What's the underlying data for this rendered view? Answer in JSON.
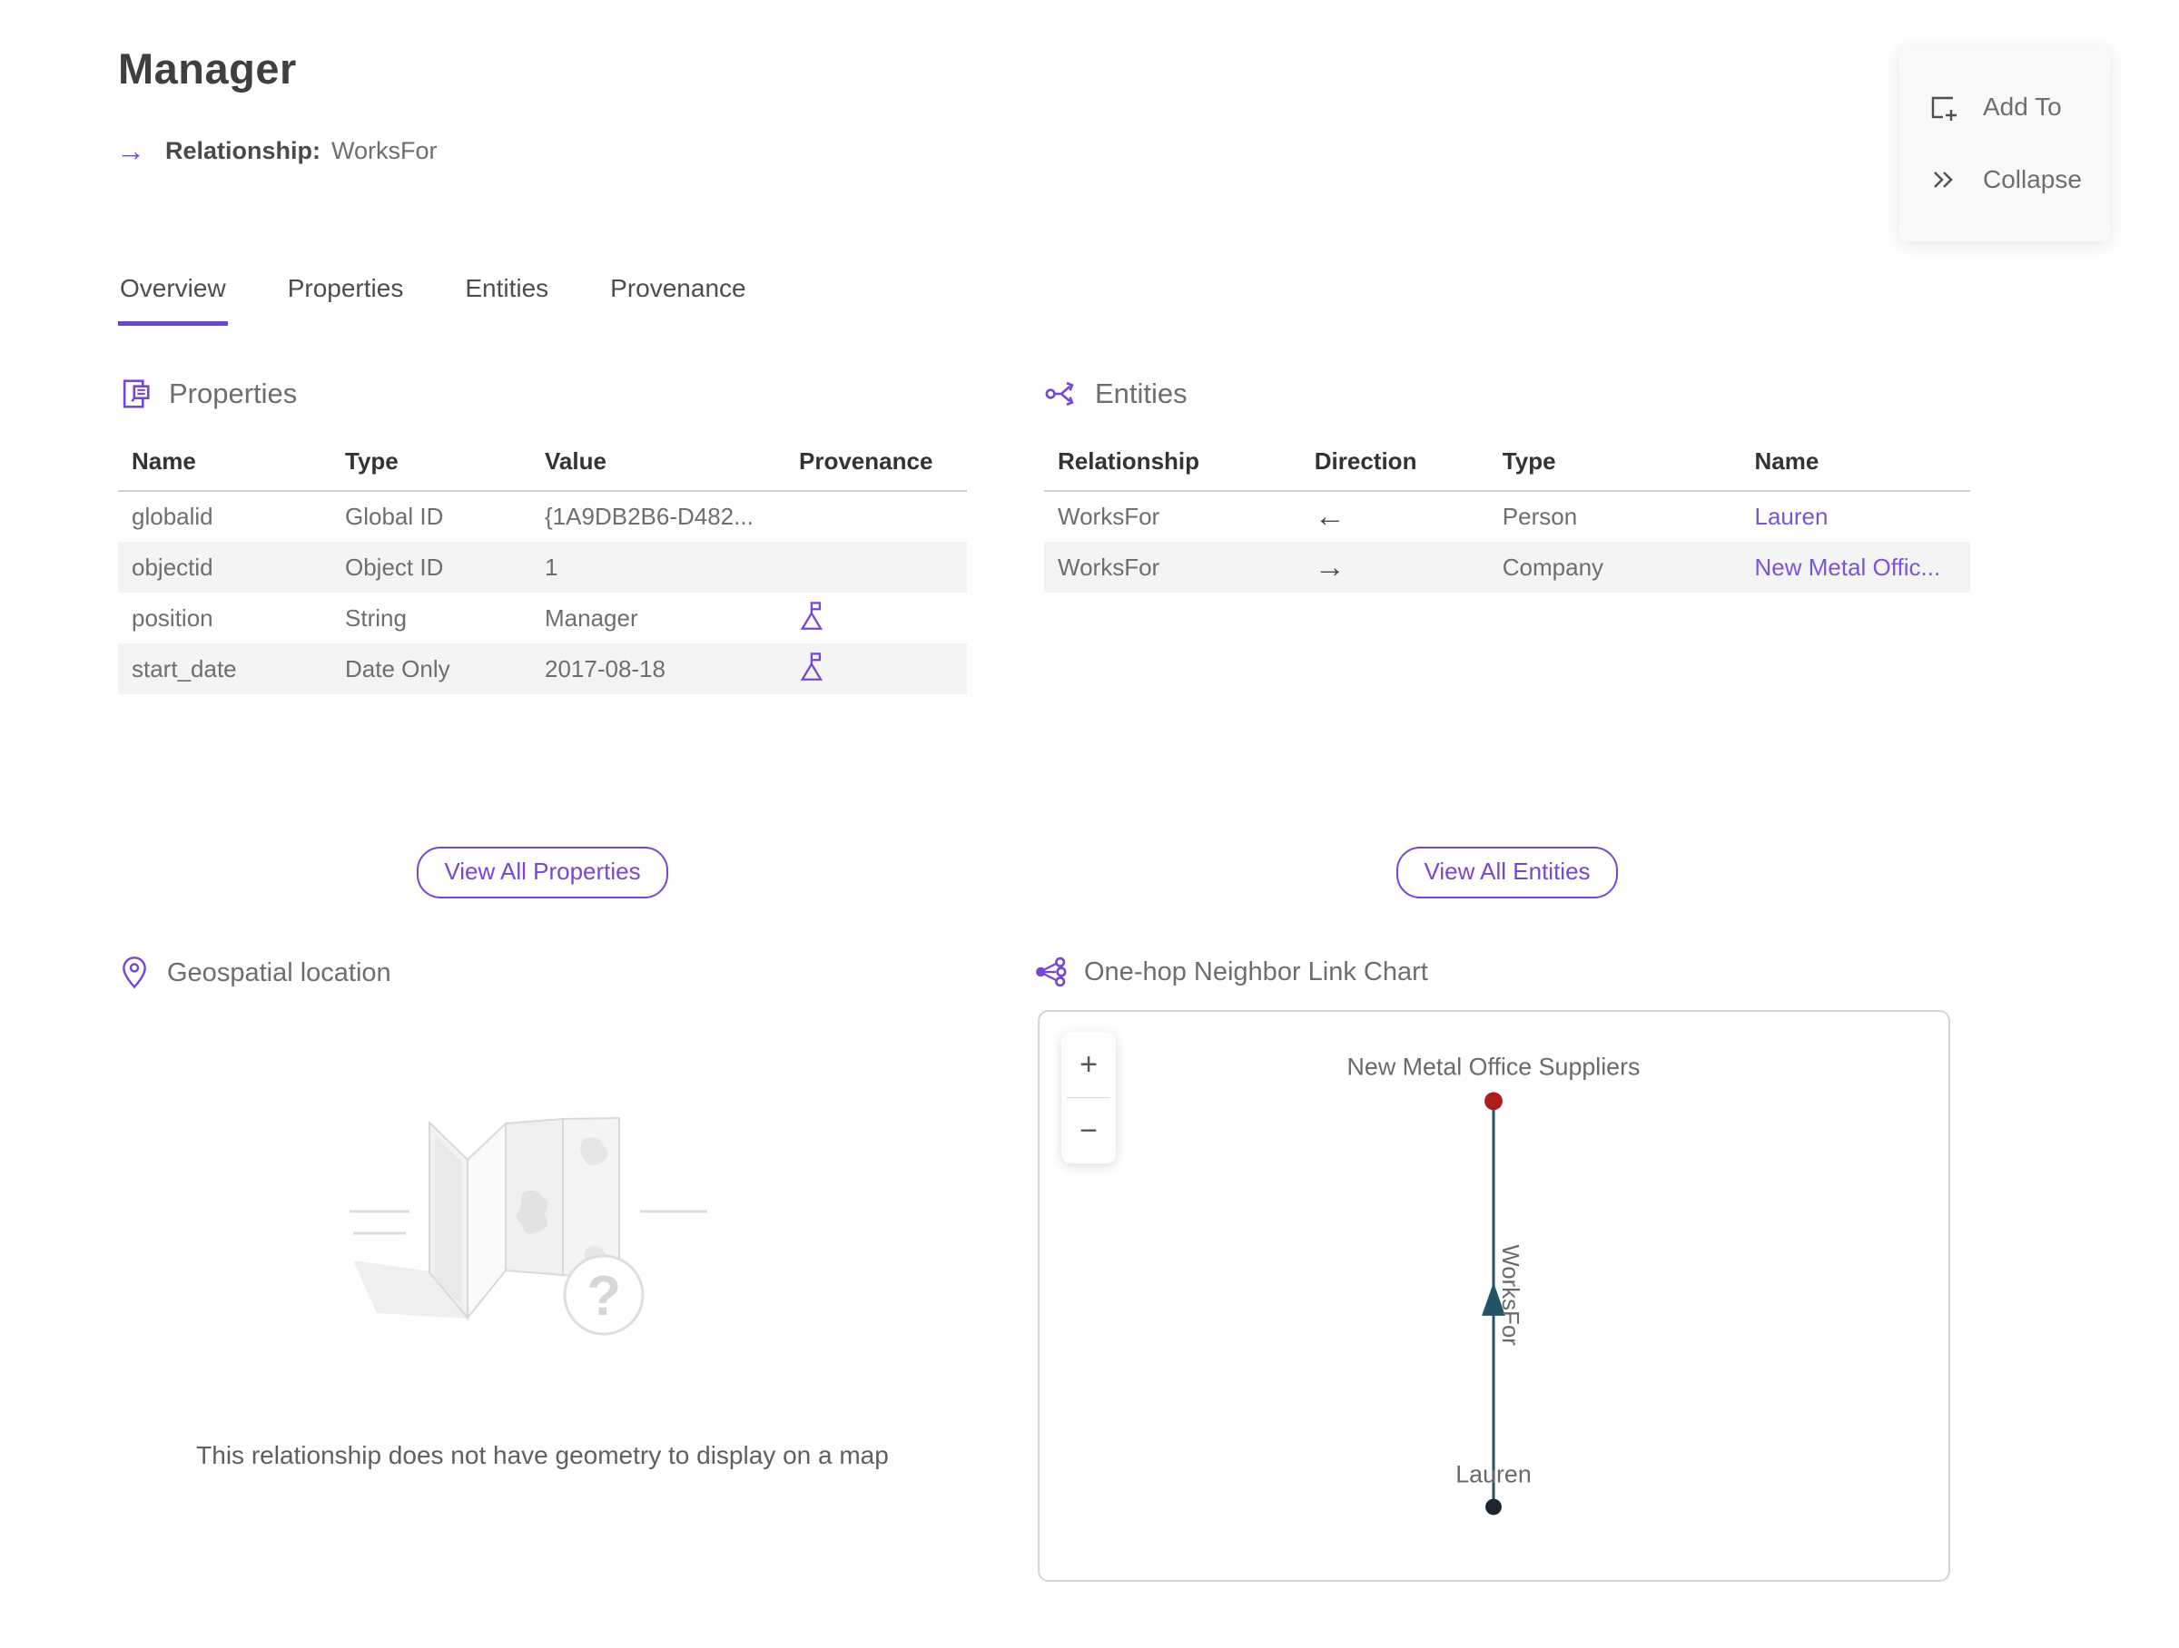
{
  "page": {
    "title": "Manager",
    "subtitle_label": "Relationship:",
    "subtitle_value": "WorksFor"
  },
  "actions": {
    "add_to": "Add To",
    "collapse": "Collapse"
  },
  "tabs": [
    {
      "label": "Overview",
      "active": true
    },
    {
      "label": "Properties",
      "active": false
    },
    {
      "label": "Entities",
      "active": false
    },
    {
      "label": "Provenance",
      "active": false
    }
  ],
  "properties_section": {
    "title": "Properties",
    "columns": [
      "Name",
      "Type",
      "Value",
      "Provenance"
    ],
    "rows": [
      {
        "name": "globalid",
        "type": "Global ID",
        "value": "{1A9DB2B6-D482...",
        "has_provenance": false
      },
      {
        "name": "objectid",
        "type": "Object ID",
        "value": "1",
        "has_provenance": false
      },
      {
        "name": "position",
        "type": "String",
        "value": "Manager",
        "has_provenance": true
      },
      {
        "name": "start_date",
        "type": "Date Only",
        "value": "2017-08-18",
        "has_provenance": true
      }
    ],
    "view_all_label": "View All Properties"
  },
  "entities_section": {
    "title": "Entities",
    "columns": [
      "Relationship",
      "Direction",
      "Type",
      "Name"
    ],
    "rows": [
      {
        "relationship": "WorksFor",
        "direction": "←",
        "type": "Person",
        "name": "Lauren"
      },
      {
        "relationship": "WorksFor",
        "direction": "→",
        "type": "Company",
        "name": "New Metal Offic..."
      }
    ],
    "view_all_label": "View All Entities"
  },
  "geospatial_section": {
    "title": "Geospatial location",
    "empty_message": "This relationship does not have geometry to display on a map"
  },
  "link_chart_section": {
    "title": "One-hop Neighbor Link Chart",
    "zoom_in_label": "+",
    "zoom_out_label": "−",
    "chart": {
      "top_node": {
        "label": "New Metal Office Suppliers",
        "color": "#b01b1e"
      },
      "bottom_node": {
        "label": "Lauren",
        "color": "#1d2530"
      },
      "edge": {
        "label": "WorksFor",
        "color": "#1f5564",
        "direction": "bottom-to-top"
      }
    }
  },
  "colors": {
    "accent_purple": "#7646d4",
    "link_purple": "#7a55d6",
    "node_red": "#b01b1e",
    "node_dark": "#1d2530",
    "edge_teal": "#1f5564",
    "zebra_gray": "#f4f4f4"
  }
}
